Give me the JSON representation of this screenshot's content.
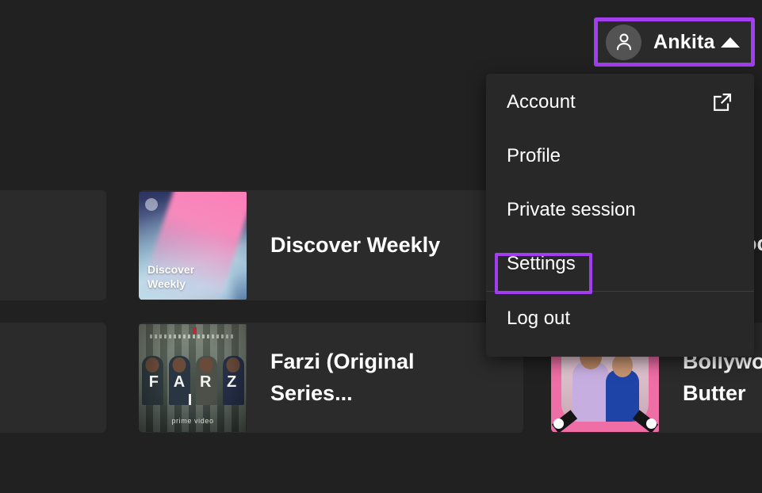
{
  "app": {
    "background_color": "#212121",
    "accent_highlight_color": "#a23ef0",
    "card_background_color": "#2b2b2b",
    "menu_background_color": "#282828"
  },
  "user_menu_button": {
    "name": "Ankita",
    "avatar_icon": "person-avatar-icon",
    "chevron_icon": "chevron-up-icon",
    "highlighted": true
  },
  "dropdown_menu": {
    "items": [
      {
        "label": "Account",
        "icon": "external-link-icon",
        "has_icon": true,
        "highlighted": false
      },
      {
        "label": "Profile",
        "icon": "",
        "has_icon": false,
        "highlighted": false
      },
      {
        "label": "Private session",
        "icon": "",
        "has_icon": false,
        "highlighted": false
      },
      {
        "label": "Settings",
        "icon": "",
        "has_icon": false,
        "highlighted": true
      },
      {
        "label": "Log out",
        "icon": "",
        "has_icon": false,
        "highlighted": false
      }
    ]
  },
  "content_cards": [
    {
      "title": "",
      "art": "empty"
    },
    {
      "title": "Discover Weekly",
      "art": "discover-weekly",
      "art_caption": "Discover\nWeekly"
    },
    {
      "title": "",
      "art": "empty"
    },
    {
      "title": "Farzi (Original Series...",
      "art": "farzi",
      "art_wordmark": "F A R Z I",
      "art_sub": "prime video"
    },
    {
      "title": "Bollywood Butter",
      "art": "bollywood-butter"
    }
  ],
  "discover_weekly": {
    "title": "Discover Weekly",
    "art_line_1": "Discover",
    "art_line_2": "Weekly"
  },
  "farzi": {
    "title_line_1": "Farzi (Original",
    "title_line_2": "Series...",
    "art_wordmark": "F A R Z I",
    "art_sub": "prime video"
  },
  "bollywood": {
    "title_line_1": "Bollywo",
    "title_line_2": "Butter"
  },
  "edge_text": "oc"
}
